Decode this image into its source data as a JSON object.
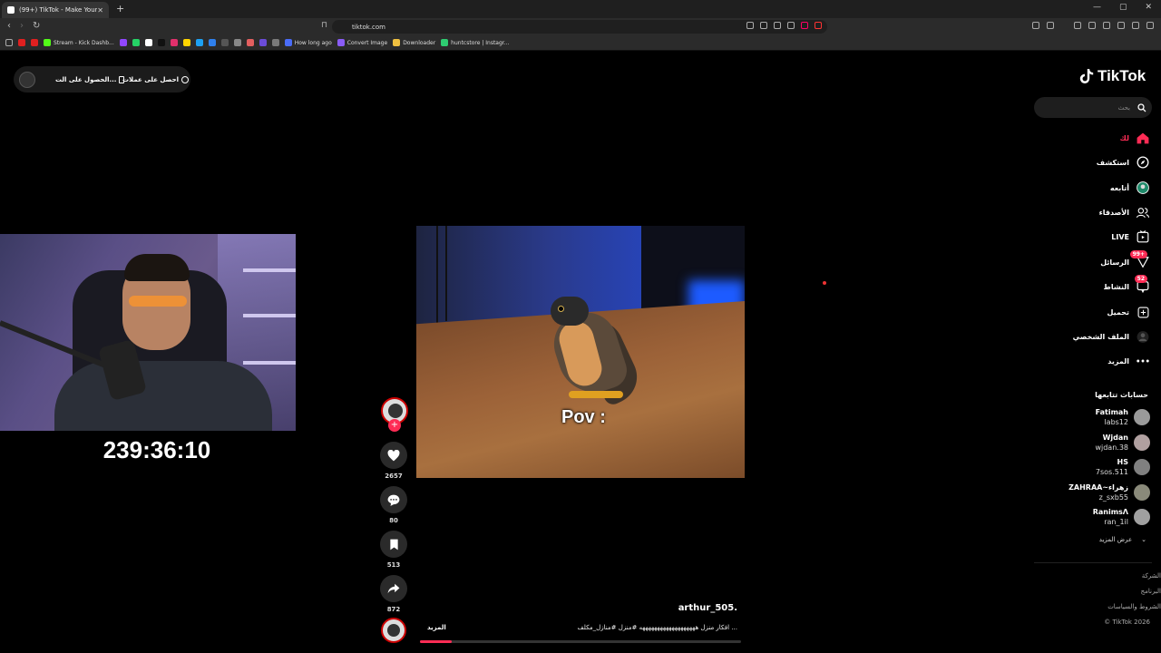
{
  "browser": {
    "tab_title": "(99+) TikTok - Make Your Day",
    "tab_close": "✕",
    "new_tab": "+",
    "window_controls": [
      "—",
      "▢",
      "✕"
    ],
    "url": "tiktok.com",
    "bookmarks": [
      {
        "label": "",
        "color": "#e02020"
      },
      {
        "label": "",
        "color": "#e02020"
      },
      {
        "label": "Stream - Kick Dashb...",
        "color": "#53fc18"
      },
      {
        "label": "",
        "color": "#9146ff"
      },
      {
        "label": "",
        "color": "#25d366"
      },
      {
        "label": "",
        "color": "#ffffff"
      },
      {
        "label": "",
        "color": "#111111"
      },
      {
        "label": "",
        "color": "#e1306c"
      },
      {
        "label": "",
        "color": "#ffd400"
      },
      {
        "label": "",
        "color": "#1da1f2"
      },
      {
        "label": "",
        "color": "#2f80ed"
      },
      {
        "label": "",
        "color": "#555555"
      },
      {
        "label": "",
        "color": "#888888"
      },
      {
        "label": "",
        "color": "#e25f5f"
      },
      {
        "label": "",
        "color": "#6b4cd8"
      },
      {
        "label": "",
        "color": "#7a7a7a"
      },
      {
        "label": "How long ago",
        "color": "#4a6cf7"
      },
      {
        "label": "Convert Image",
        "color": "#8a5cf6"
      },
      {
        "label": "Downloader",
        "color": "#f0c040"
      },
      {
        "label": "huntcstore | Instagr...",
        "color": "#2ecc71"
      }
    ]
  },
  "top_pill": {
    "item1": "الحصول على الت...",
    "item2": "احصل على عملات"
  },
  "stream": {
    "timer": "239:36:10"
  },
  "video": {
    "caption": "Pov :",
    "author": "arthur_505.",
    "description": "افكار منزل هههههههههههههههههههه #منزل #منازل_مكلف ...",
    "more": "المزيد",
    "progress": 0.1
  },
  "actions": {
    "follow": "+",
    "likes": "2657",
    "comments": "80",
    "saves": "513",
    "shares": "872"
  },
  "sidebar": {
    "logo": "TikTok",
    "search_placeholder": "بحث",
    "nav": [
      {
        "label": "لك",
        "icon": "home-icon",
        "accent": true
      },
      {
        "label": "استكشف",
        "icon": "compass-icon"
      },
      {
        "label": "أتابعه",
        "icon": "following-avatar-icon"
      },
      {
        "label": "الأصدقاء",
        "icon": "friends-icon"
      },
      {
        "label": "LIVE",
        "icon": "live-icon"
      },
      {
        "label": "الرسائل",
        "icon": "messages-icon",
        "badge": "99+"
      },
      {
        "label": "النشاط",
        "icon": "activity-icon",
        "badge": "52"
      },
      {
        "label": "تحميل",
        "icon": "upload-icon"
      },
      {
        "label": "الملف الشخصي",
        "icon": "profile-icon"
      },
      {
        "label": "المزيد",
        "icon": "more-dots-icon"
      }
    ],
    "following_title": "حسابات تتابعها",
    "following": [
      {
        "name": "Fatimah",
        "handle": "labs12",
        "color": "#9a9a9a"
      },
      {
        "name": "Wjdan",
        "handle": "wjdan.38",
        "color": "#b0a0a0"
      },
      {
        "name": "HS",
        "handle": "7sos.511",
        "color": "#808080"
      },
      {
        "name": "ZAHRAA~زهراء",
        "handle": "z_sxb55",
        "color": "#8a8a7a"
      },
      {
        "name": "RanimsɅ",
        "handle": "ran_1il",
        "color": "#a0a0a0"
      }
    ],
    "see_more": "عرض المزيد",
    "footer": [
      "الشركة",
      "البرنامج",
      "الشروط والسياسات",
      "© TikTok 2026"
    ]
  },
  "colors": {
    "accent": "#fe2c55",
    "bg": "#000000"
  }
}
